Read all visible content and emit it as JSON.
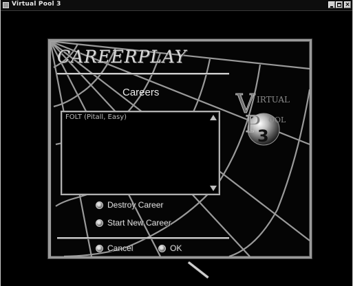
{
  "window": {
    "title": "Virtual Pool 3"
  },
  "screen": {
    "logo_text": "CAREERPLAY",
    "heading": "Careers",
    "careers_list": [
      "FOLT (Pitall, Easy)"
    ],
    "brand": {
      "v_letter": "V",
      "irtual": "IRTUAL",
      "p_letter": "P",
      "ool": "OOL",
      "number": "3"
    },
    "options": {
      "destroy_career": "Destroy Career",
      "start_new_career": "Start New Career",
      "cancel": "Cancel",
      "ok": "OK"
    }
  },
  "colors": {
    "background": "#000000",
    "text": "#dadada",
    "frame": "#9a9a9a"
  }
}
